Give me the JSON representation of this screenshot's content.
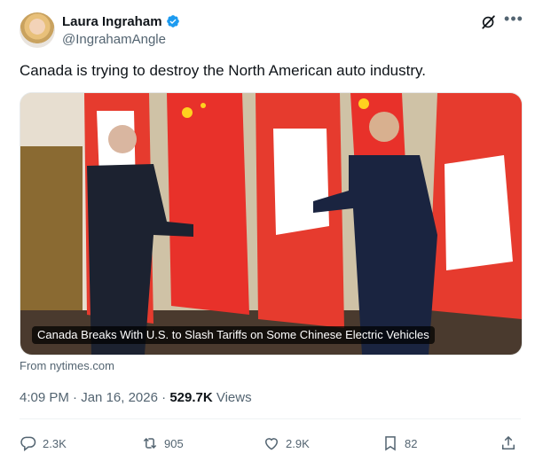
{
  "author": {
    "name": "Laura Ingraham",
    "handle": "@IngrahamAngle"
  },
  "tweet": {
    "text": "Canada is trying to destroy the North American auto industry.",
    "media_caption": "Canada Breaks With U.S. to Slash Tariffs on Some Chinese Electric Vehicles",
    "source": "From nytimes.com"
  },
  "meta": {
    "time": "4:09 PM",
    "separator": "·",
    "date": "Jan 16, 2026",
    "views_count": "529.7K",
    "views_label": "Views"
  },
  "actions": {
    "replies": "2.3K",
    "reposts": "905",
    "likes": "2.9K",
    "bookmarks": "82"
  },
  "colors": {
    "verified": "#1d9bf0",
    "text": "#0f1419",
    "muted": "#536471"
  }
}
